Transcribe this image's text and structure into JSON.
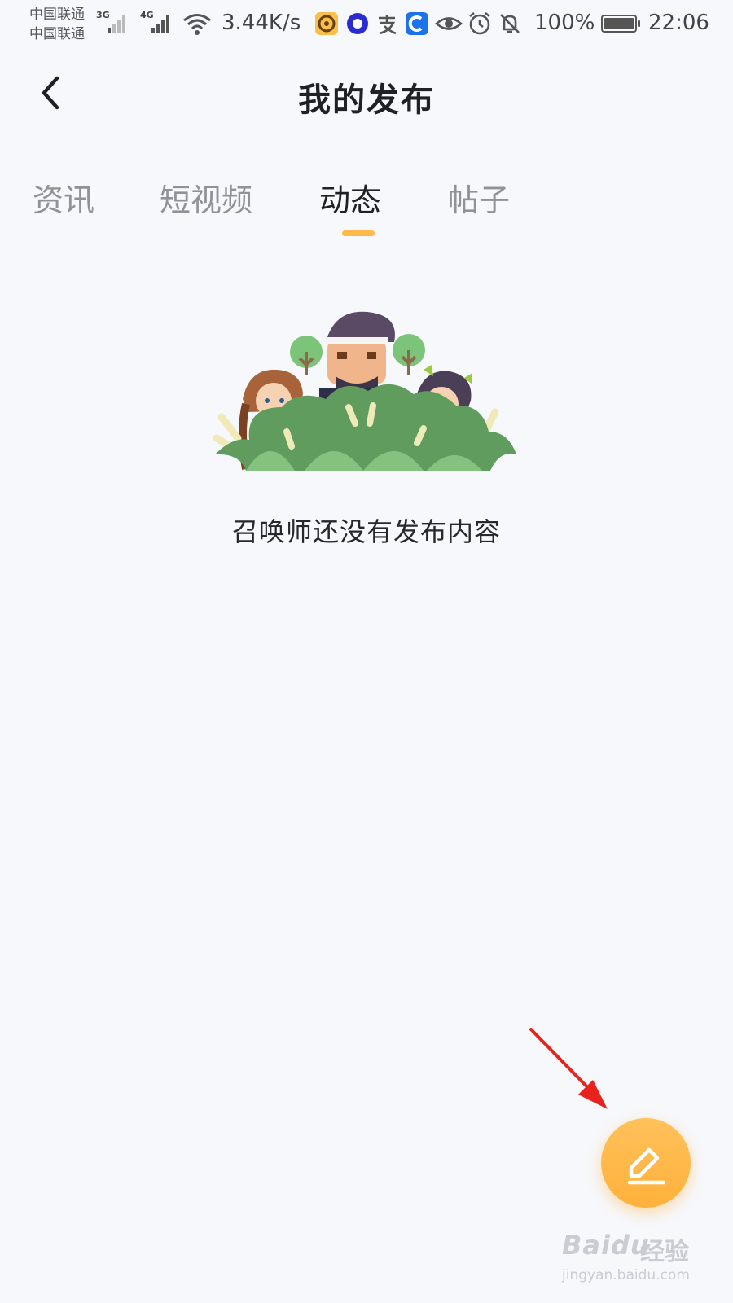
{
  "status_bar": {
    "carrier_1": "中国联通",
    "carrier_2": "中国联通",
    "network_1": "3G",
    "network_2": "4G",
    "speed": "3.44K/s",
    "battery": "100%",
    "time": "22:06"
  },
  "header": {
    "title": "我的发布",
    "back_icon": "chevron-left-icon"
  },
  "tabs": [
    {
      "label": "资讯",
      "active": false
    },
    {
      "label": "短视频",
      "active": false
    },
    {
      "label": "动态",
      "active": true
    },
    {
      "label": "帖子",
      "active": false
    }
  ],
  "empty_state": {
    "message": "召唤师还没有发布内容",
    "illustration": "heroes-hiding-in-bush-illustration"
  },
  "fab": {
    "icon": "edit-pencil-icon",
    "color": "#ffb84a"
  },
  "watermark": {
    "brand": "Baidu",
    "brand_cn": "经验",
    "url": "jingyan.baidu.com"
  },
  "colors": {
    "accent": "#ffb84a",
    "background": "#f7f8fc",
    "annotation_arrow": "#e8231e"
  }
}
